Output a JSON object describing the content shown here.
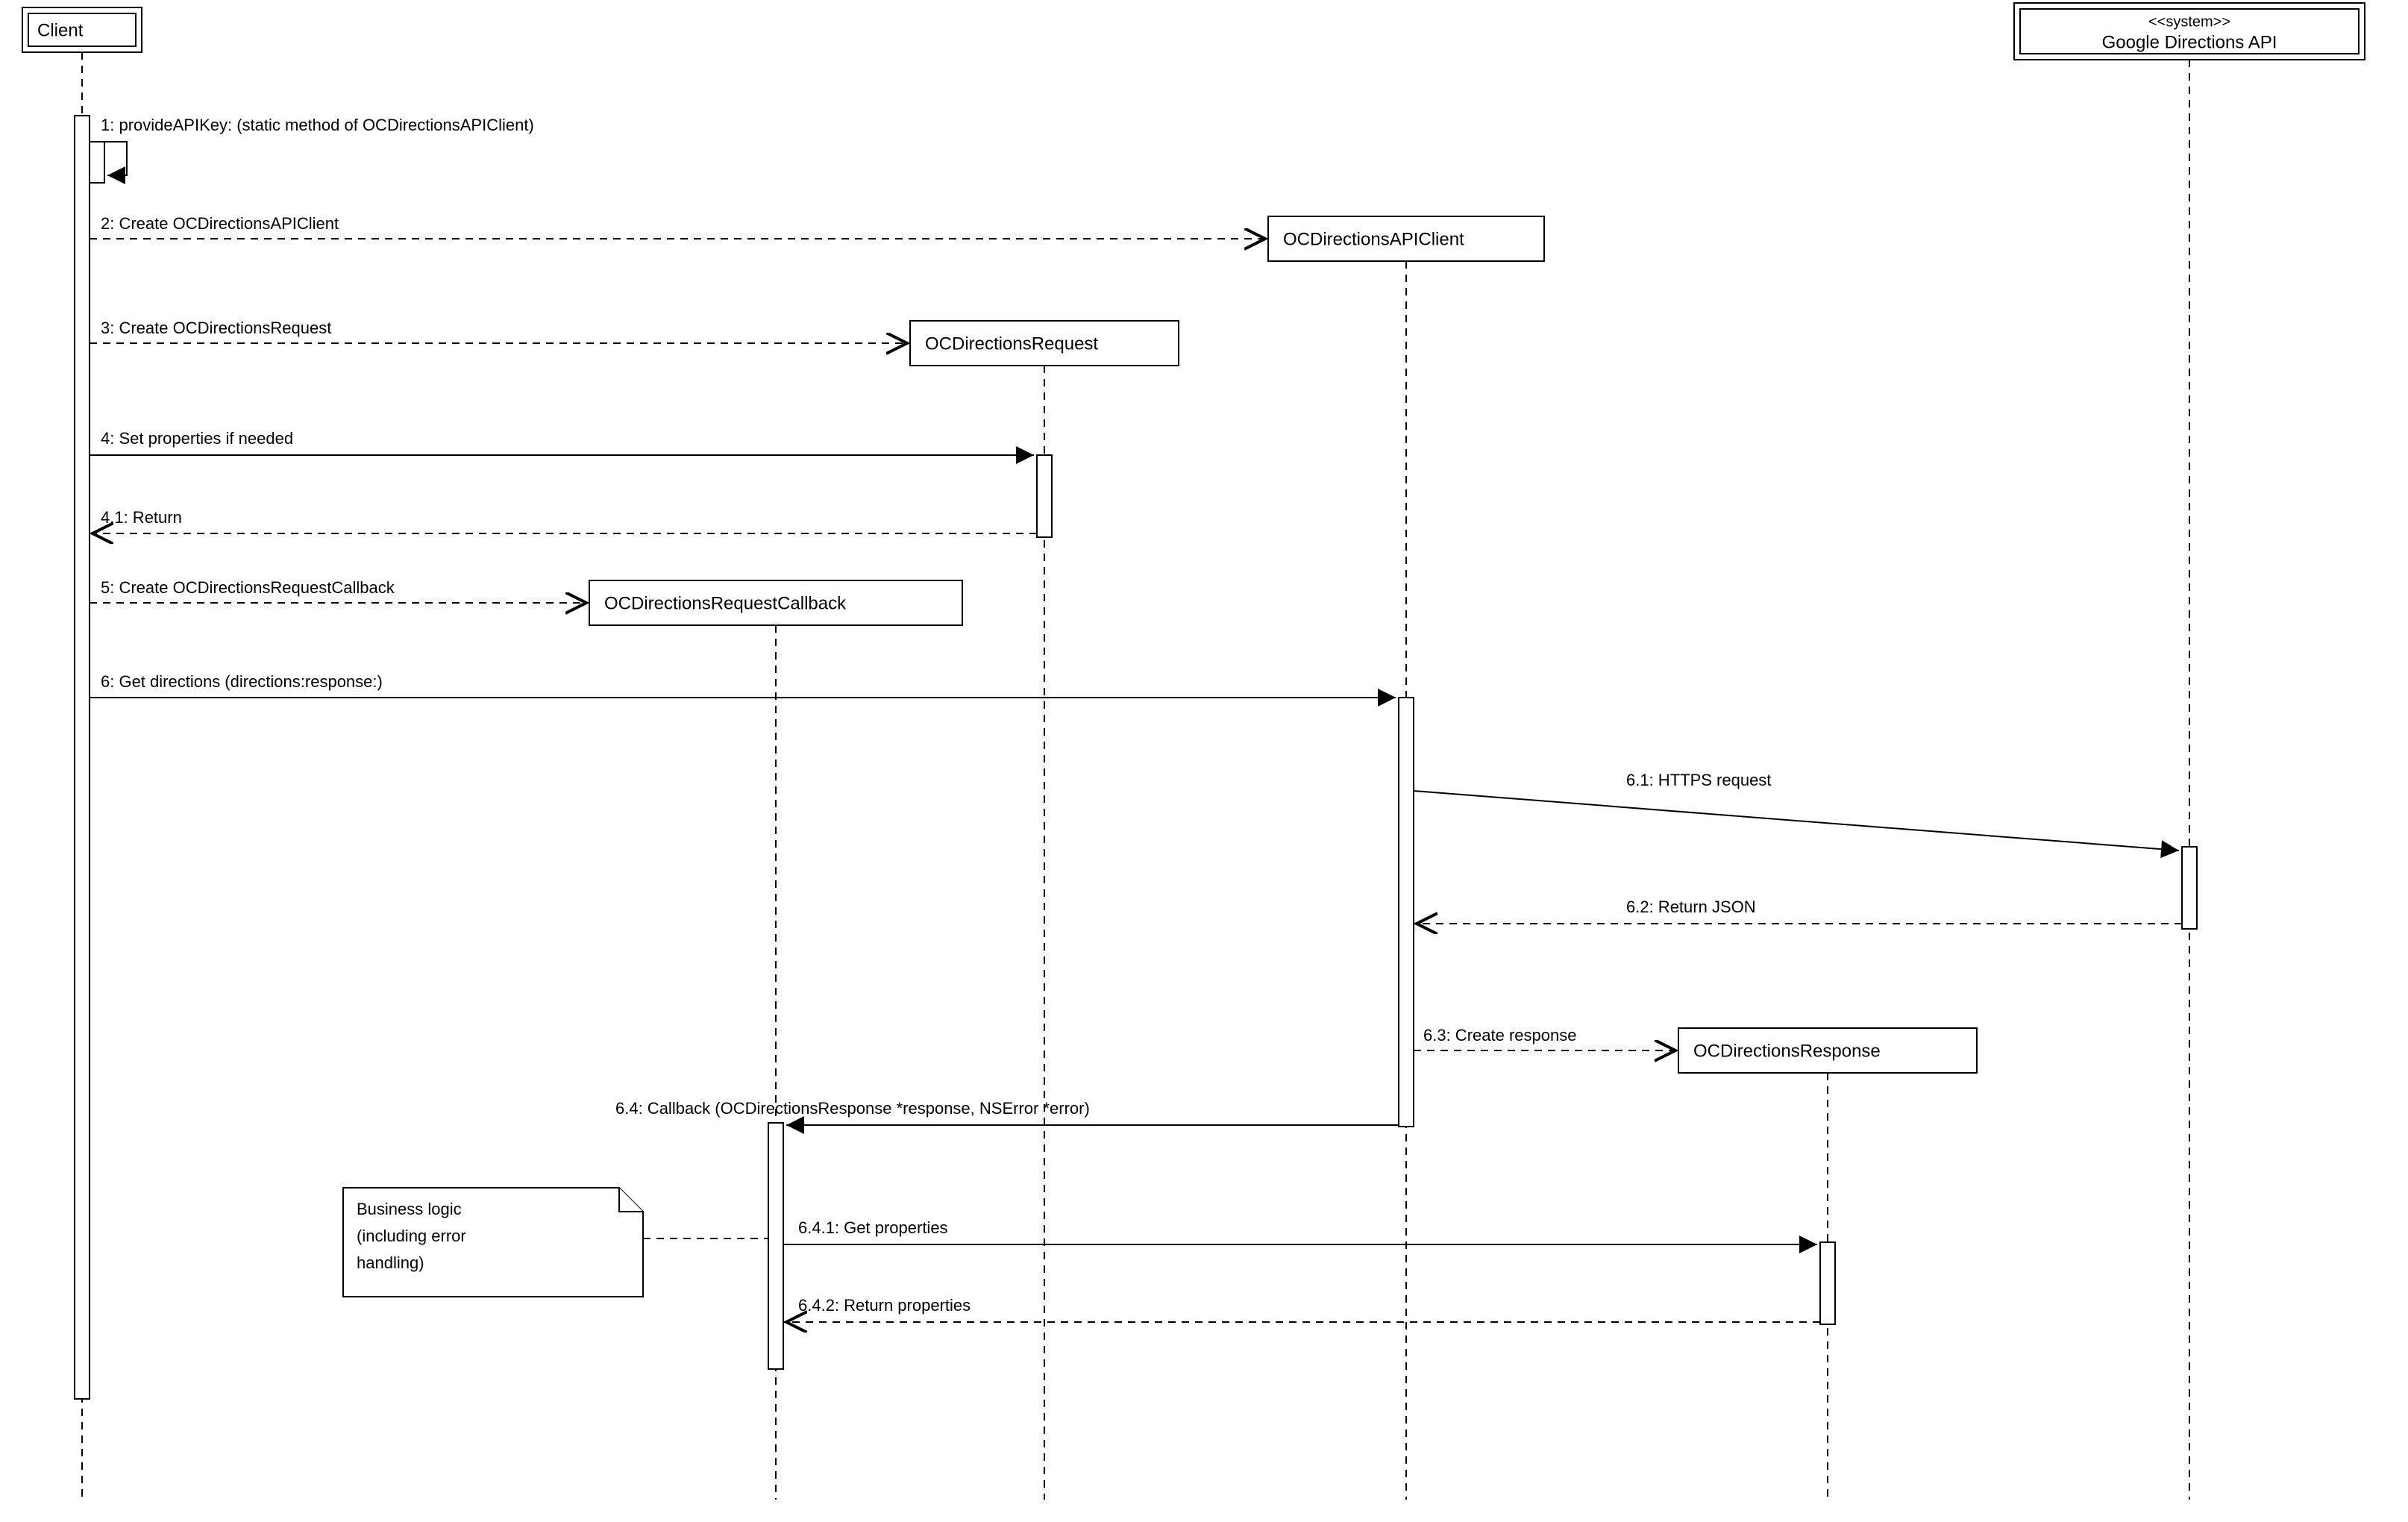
{
  "participants": {
    "client": "Client",
    "api_client": "OCDirectionsAPIClient",
    "request": "OCDirectionsRequest",
    "callback": "OCDirectionsRequestCallback",
    "response": "OCDirectionsResponse",
    "google_stereotype": "<<system>>",
    "google": "Google Directions API"
  },
  "messages": {
    "m1": "1:  provideAPIKey: (static method of OCDirectionsAPIClient)",
    "m2": "2: Create OCDirectionsAPIClient",
    "m3": "3: Create OCDirectionsRequest",
    "m4": "4: Set properties if needed",
    "m41": "4.1: Return",
    "m5": "5: Create OCDirectionsRequestCallback",
    "m6": "6: Get directions (directions:response:)",
    "m61": "6.1: HTTPS request",
    "m62": "6.2: Return JSON",
    "m63": "6.3: Create response",
    "m64": "6.4: Callback (OCDirectionsResponse *response, NSError *error)",
    "m641": "6.4.1: Get properties",
    "m642": "6.4.2: Return properties"
  },
  "note": {
    "line1": "Business logic",
    "line2": "(including error",
    "line3": "handling)"
  }
}
